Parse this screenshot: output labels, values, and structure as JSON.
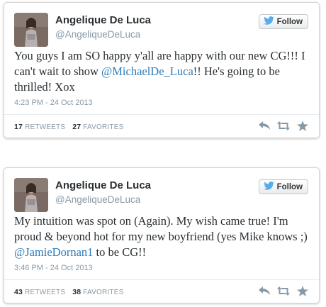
{
  "tweets": [
    {
      "name": "Angelique De Luca",
      "handle": "@AngeliqueDeLuca",
      "follow_label": "Follow",
      "text_parts": [
        {
          "text": "You guys I am SO happy y'all are happy with our new CG!!! I can't wait to show "
        },
        {
          "text": "@MichaelDe_Luca",
          "mention": true
        },
        {
          "text": "!! He's going to be thrilled! Xox"
        }
      ],
      "time": "4:23 PM - 24 Oct 2013",
      "retweets": "17",
      "retweets_label": "RETWEETS",
      "favorites": "27",
      "favorites_label": "FAVORITES"
    },
    {
      "name": "Angelique De Luca",
      "handle": "@AngeliqueDeLuca",
      "follow_label": "Follow",
      "text_parts": [
        {
          "text": "My intuition was spot on (Again). My wish came true! I'm proud & beyond hot for my new boyfriend (yes Mike knows ;) "
        },
        {
          "text": "@JamieDornan1",
          "mention": true
        },
        {
          "text": " to be CG!!"
        }
      ],
      "time": "3:46 PM - 24 Oct 2013",
      "retweets": "43",
      "retweets_label": "RETWEETS",
      "favorites": "38",
      "favorites_label": "FAVORITES"
    }
  ],
  "icons": {
    "follow": "twitter-bird-icon",
    "reply": "reply-icon",
    "retweet": "retweet-icon",
    "favorite": "star-icon"
  },
  "colors": {
    "mention": "#2b7bb9",
    "bird": "#55acee",
    "muted": "#8899a6",
    "text": "#292f33"
  }
}
